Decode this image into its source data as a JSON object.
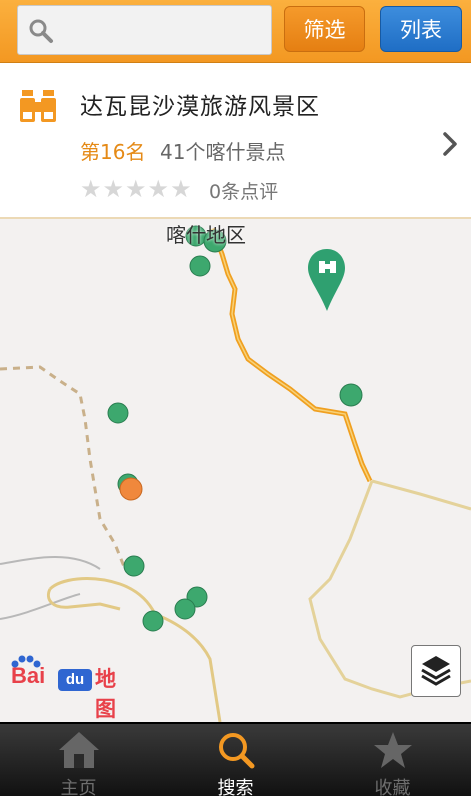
{
  "search": {
    "placeholder": ""
  },
  "toolbar": {
    "filter_label": "筛选",
    "list_label": "列表"
  },
  "card": {
    "title": "达瓦昆沙漠旅游风景区",
    "rank": "第16名",
    "count": "41个喀什景点",
    "stars": "★★★★★",
    "rating": 0,
    "reviews": "0条点评",
    "icon": "binoculars-icon"
  },
  "map": {
    "region_label": "喀什地区",
    "logo": {
      "bai": "Bai",
      "du": "du",
      "map": "地图"
    }
  },
  "nav": {
    "items": [
      {
        "label": "主页",
        "icon": "home-icon",
        "active": false
      },
      {
        "label": "搜索",
        "icon": "search-icon",
        "active": true
      },
      {
        "label": "收藏",
        "icon": "star-icon",
        "active": false
      }
    ]
  },
  "colors": {
    "accent": "#f39822",
    "list_button": "#2a7bd1",
    "marker": "#3da86e",
    "selected_marker": "#f0883c"
  }
}
